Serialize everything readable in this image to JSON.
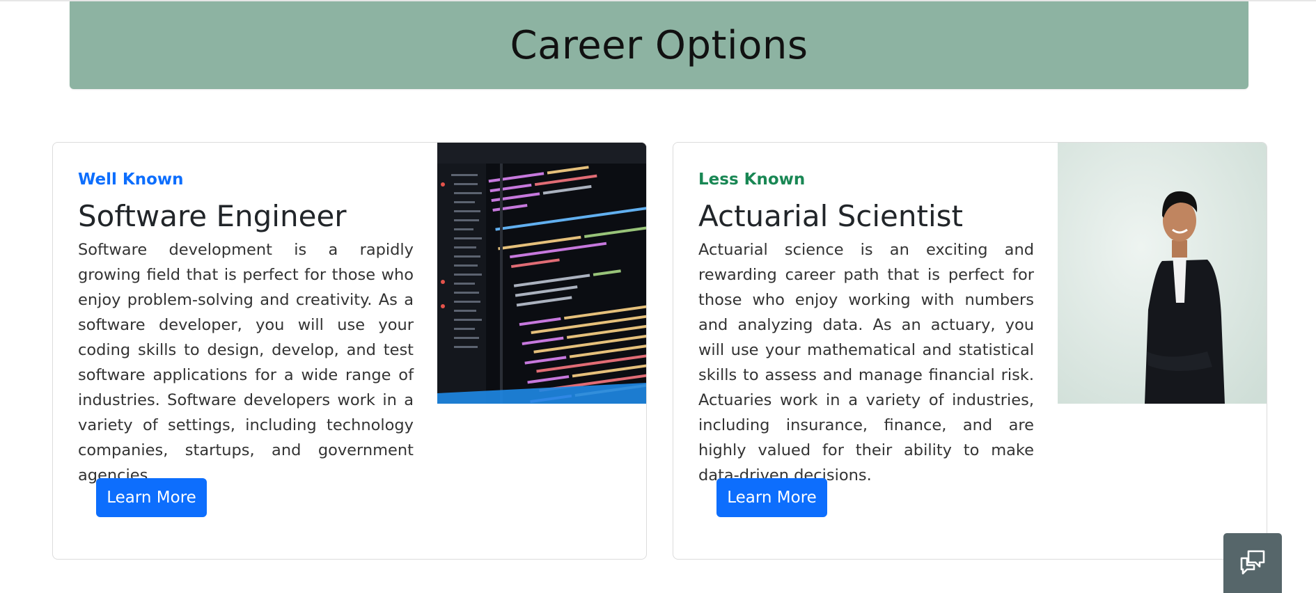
{
  "header": {
    "title": "Career Options"
  },
  "cards": [
    {
      "tag": "Well Known",
      "title": "Software Engineer",
      "description": "Software development is a rapidly growing field that is perfect for those who enjoy problem-solving and creativity. As a software developer, you will use your coding skills to design, develop, and test software applications for a wide range of industries. Software developers work in a variety of settings, including technology companies, startups, and government agencies.",
      "button_label": "Learn More",
      "image_icon": "code-screen-photo"
    },
    {
      "tag": "Less Known",
      "title": "Actuarial Scientist",
      "description": "Actuarial science is an exciting and rewarding career path that is perfect for those who enjoy working with numbers and analyzing data. As an actuary, you will use your mathematical and statistical skills to assess and manage financial risk. Actuaries work in a variety of industries, including insurance, finance, and are highly valued for their ability to make data-driven decisions.",
      "button_label": "Learn More",
      "image_icon": "professional-man-photo"
    }
  ],
  "chat_widget": {
    "icon": "chat-bubbles-icon"
  },
  "colors": {
    "banner": "#8db3a2",
    "tag_well_known": "#0d6efd",
    "tag_less_known": "#198754",
    "button": "#0d6efd",
    "chat_widget": "#56666a"
  }
}
